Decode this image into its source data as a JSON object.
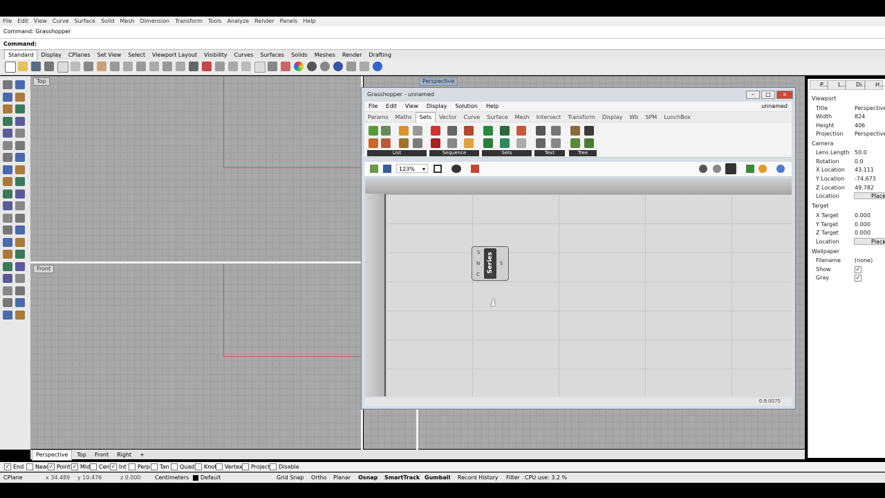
{
  "menu": [
    "File",
    "Edit",
    "View",
    "Curve",
    "Surface",
    "Solid",
    "Mesh",
    "Dimension",
    "Transform",
    "Tools",
    "Analyze",
    "Render",
    "Panels",
    "Help"
  ],
  "command_history": "Command: Grasshopper",
  "command_prompt": "Command:",
  "toolbar_tabs": [
    "Standard",
    "Display",
    "CPlanes",
    "Set View",
    "Select",
    "Viewport Layout",
    "Visibility",
    "Curves",
    "Surfaces",
    "Solids",
    "Meshes",
    "Render",
    "Drafting"
  ],
  "viewports": {
    "top": "Top",
    "front": "Front",
    "perspective": "Perspective"
  },
  "viewport_tabs": [
    "Perspective",
    "Top",
    "Front",
    "Right",
    "+"
  ],
  "osnaps": [
    {
      "label": "End",
      "checked": true
    },
    {
      "label": "Near",
      "checked": false
    },
    {
      "label": "Point",
      "checked": true
    },
    {
      "label": "Mid",
      "checked": true
    },
    {
      "label": "Cen",
      "checked": false
    },
    {
      "label": "Int",
      "checked": true
    },
    {
      "label": "Perp",
      "checked": false
    },
    {
      "label": "Tan",
      "checked": false
    },
    {
      "label": "Quad",
      "checked": false
    },
    {
      "label": "Knot",
      "checked": false
    },
    {
      "label": "Vertex",
      "checked": false
    },
    {
      "label": "Project",
      "checked": false
    },
    {
      "label": "Disable",
      "checked": false
    }
  ],
  "status": {
    "cplane": "CPlane",
    "x": "x 34.489",
    "y": "y 10.476",
    "z": "z 0.000",
    "units": "Centimeters",
    "layer": "Default",
    "grid_snap": "Grid Snap",
    "ortho": "Ortho",
    "planar": "Planar",
    "osnap": "Osnap",
    "smarttrack": "SmartTrack",
    "gumball": "Gumball",
    "record_history": "Record History",
    "filter": "Filter",
    "cpu": "CPU use: 3.2 %"
  },
  "properties": {
    "tabs": [
      "P...",
      "L...",
      "Di...",
      "H..."
    ],
    "viewport_section": "Viewport",
    "title_k": "Title",
    "title_v": "Perspective",
    "width_k": "Width",
    "width_v": "824",
    "height_k": "Height",
    "height_v": "406",
    "projection_k": "Projection",
    "projection_v": "Perspective",
    "camera_section": "Camera",
    "lens_k": "Lens Length",
    "lens_v": "50.0",
    "rotation_k": "Rotation",
    "rotation_v": "0.0",
    "xloc_k": "X Location",
    "xloc_v": "43.111",
    "yloc_k": "Y Location",
    "yloc_v": "-74.673",
    "zloc_k": "Z Location",
    "zloc_v": "49.782",
    "loc_k": "Location",
    "place_btn": "Place...",
    "target_section": "Target",
    "xt_k": "X Target",
    "xt_v": "0.000",
    "yt_k": "Y Target",
    "yt_v": "0.000",
    "zt_k": "Z Target",
    "zt_v": "0.000",
    "tloc_k": "Location",
    "tplace_btn": "Place...",
    "wallpaper_section": "Wallpaper",
    "filename_k": "Filename",
    "filename_v": "(none)",
    "show_k": "Show",
    "gray_k": "Gray"
  },
  "grasshopper": {
    "title": "Grasshopper - unnamed",
    "doc_name": "unnamed",
    "menu": [
      "File",
      "Edit",
      "View",
      "Display",
      "Solution",
      "Help"
    ],
    "tabs": [
      "Params",
      "Maths",
      "Sets",
      "Vector",
      "Curve",
      "Surface",
      "Mesh",
      "Intersect",
      "Transform",
      "Display",
      "Wb",
      "SPM",
      "LunchBox"
    ],
    "active_tab": "Sets",
    "groups": [
      "List",
      "Sequence",
      "Sets",
      "Text",
      "Tree"
    ],
    "zoom": "123%",
    "component": {
      "name": "Series",
      "inputs": [
        "S",
        "N",
        "C"
      ],
      "output": "S"
    },
    "version": "0.9.0075"
  }
}
